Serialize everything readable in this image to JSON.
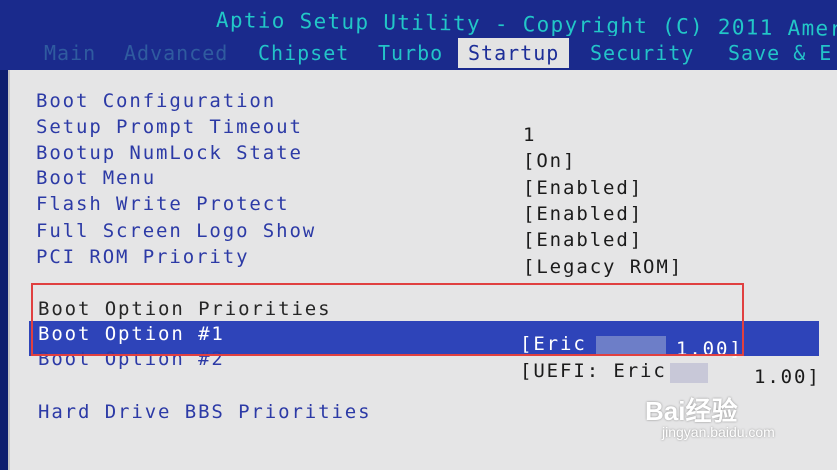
{
  "header": {
    "title": "Aptio Setup Utility - Copyright (C) 2011 Ameri"
  },
  "tabs": [
    {
      "label": "Main",
      "state": "faded"
    },
    {
      "label": "Advanced",
      "state": "faded"
    },
    {
      "label": "Chipset",
      "state": "normal"
    },
    {
      "label": "Turbo",
      "state": "normal"
    },
    {
      "label": "Startup",
      "state": "active"
    },
    {
      "label": "Security",
      "state": "normal"
    },
    {
      "label": "Save & E",
      "state": "normal"
    }
  ],
  "boot_config": {
    "heading": "Boot Configuration",
    "items": [
      {
        "label": "Setup Prompt Timeout",
        "value": "1"
      },
      {
        "label": "Bootup NumLock State",
        "value": "[On]"
      },
      {
        "label": "Boot Menu",
        "value": "[Enabled]"
      },
      {
        "label": "Flash Write Protect",
        "value": "[Enabled]"
      },
      {
        "label": "Full Screen Logo Show",
        "value": "[Enabled]"
      },
      {
        "label": "PCI ROM Priority",
        "value": "[Legacy ROM]"
      }
    ]
  },
  "boot_priorities": {
    "heading": "Boot Option Priorities",
    "options": [
      {
        "label": "Boot Option #1",
        "value_prefix": "[Eric",
        "value_suffix": "1.00]"
      },
      {
        "label": "Boot Option #2",
        "value_prefix": "[UEFI: Eric",
        "value_suffix": "1.00]"
      }
    ]
  },
  "hdd_link": "Hard Drive BBS Priorities",
  "watermark": {
    "brand": "Bai经验",
    "url": "jingyan.baidu.com"
  },
  "colors": {
    "background_blue": "#0d1e6e",
    "panel_gray": "#e5e5e6",
    "label_blue": "#2c3aa6",
    "highlight_blue": "#2e44b9",
    "annotation_red": "#e04040",
    "title_cyan": "#22c7c7"
  }
}
